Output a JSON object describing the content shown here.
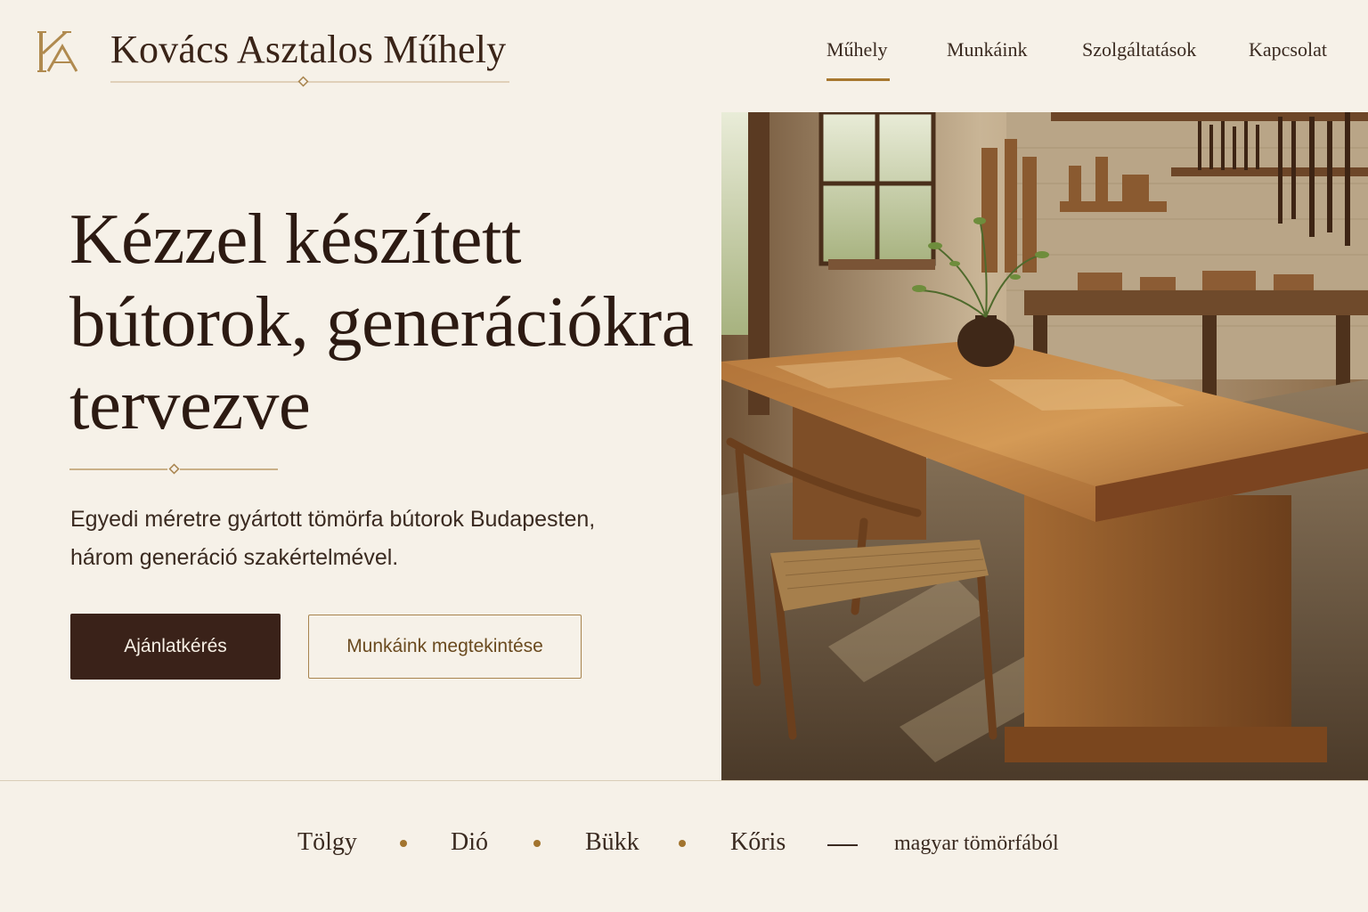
{
  "brand": {
    "name": "Kovács Asztalos Műhely",
    "logo_icon": "monogram-ka-icon",
    "accent_color": "#a8782f"
  },
  "nav": {
    "items": [
      {
        "label": "Műhely",
        "active": true
      },
      {
        "label": "Munkáink",
        "active": false
      },
      {
        "label": "Szolgáltatások",
        "active": false
      },
      {
        "label": "Kapcsolat",
        "active": false
      }
    ]
  },
  "hero": {
    "title": "Kézzel készített bútorok, generációkra tervezve",
    "subtitle": "Egyedi méretre gyártott tömörfa bútorok Budapesten, három generáció szakértelmével.",
    "primary_button": "Ajánlatkérés",
    "secondary_button": "Munkáink megtekintése",
    "image_icon": "workshop-table-photo",
    "primary_color": "#3a2219"
  },
  "woods": {
    "items": [
      "Tölgy",
      "Dió",
      "Bükk",
      "Kőris"
    ],
    "tail": "magyar tömörfából"
  }
}
